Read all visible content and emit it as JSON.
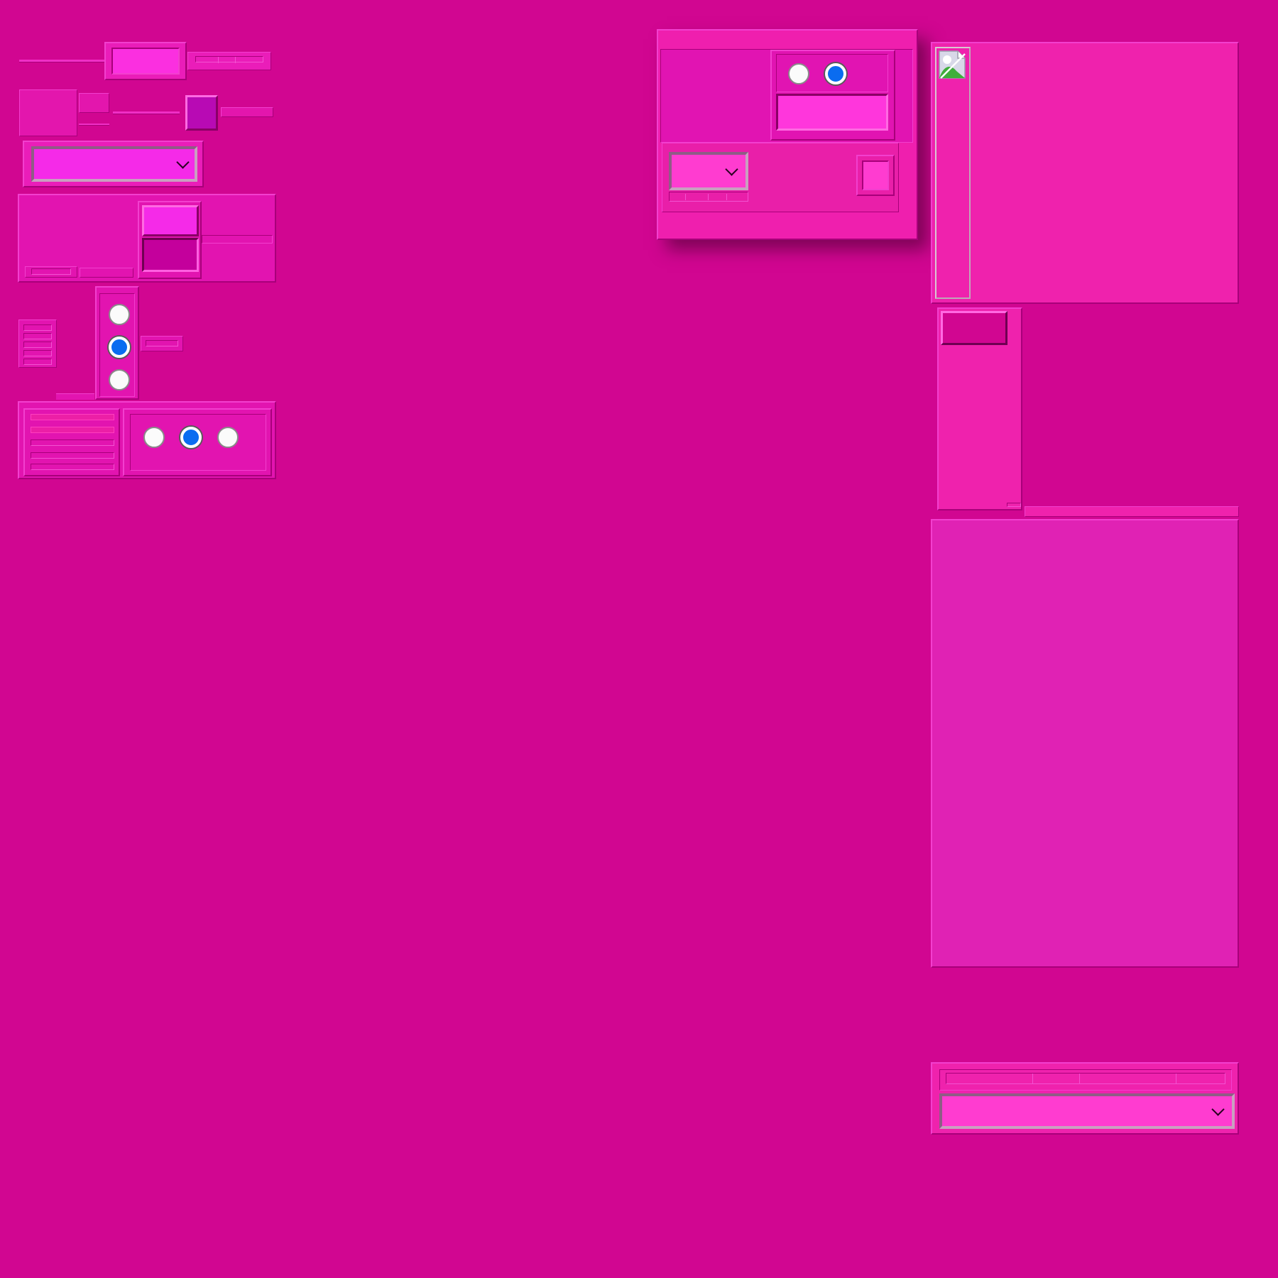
{
  "app": {
    "background": "#d10691",
    "accent": "#0a6cf0"
  },
  "left_panel": {
    "text_field": {
      "value": ""
    },
    "dropdown": {
      "selected": "",
      "icon": "chevron-down-icon"
    },
    "radio_group_vertical": {
      "options": [
        "",
        "",
        ""
      ],
      "selected_index": 1
    },
    "radio_group_horizontal": {
      "options": [
        "",
        "",
        ""
      ],
      "selected_index": 1
    }
  },
  "dialog": {
    "radio_group": {
      "options": [
        "",
        ""
      ],
      "selected_index": 1
    },
    "dropdown": {
      "selected": "",
      "icon": "chevron-down-icon"
    },
    "text_field": {
      "value": ""
    }
  },
  "right_panel": {
    "image": {
      "icon": "broken-image-icon"
    },
    "button": {
      "label": ""
    },
    "dropdown": {
      "selected": "",
      "icon": "chevron-down-icon"
    }
  }
}
